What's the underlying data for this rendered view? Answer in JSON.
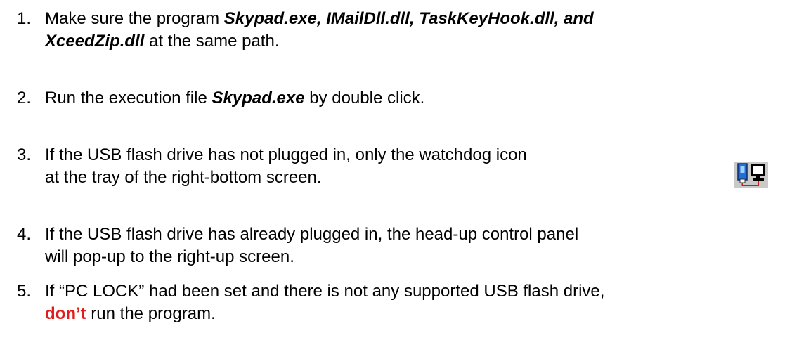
{
  "colors": {
    "text": "#000000",
    "emphasis_red": "#e31b1b"
  },
  "steps": [
    {
      "number": "1.",
      "line1_a": "Make sure the program ",
      "line1_b": "Skypad.exe, IMailDll.dll, TaskKeyHook.dll, and",
      "line2_a": "XceedZip.dll",
      "line2_b": " at the same path."
    },
    {
      "number": "2.",
      "a": "Run the execution file ",
      "b": "Skypad.exe",
      "c": " by double click."
    },
    {
      "number": "3.",
      "line1": "If the USB flash drive has not plugged in, only the watchdog icon",
      "line2": "at the tray of the right-bottom screen.",
      "icon": "usb-watchdog-tray-icon"
    },
    {
      "number": "4.",
      "line1": "If the USB flash drive has already plugged in, the head-up control panel",
      "line2": "will pop-up to the right-up screen."
    },
    {
      "number": "5.",
      "line1": "If “PC LOCK” had been set and there is not any supported USB flash drive,",
      "line2_a": "don’t",
      "line2_b": " run the program."
    }
  ]
}
